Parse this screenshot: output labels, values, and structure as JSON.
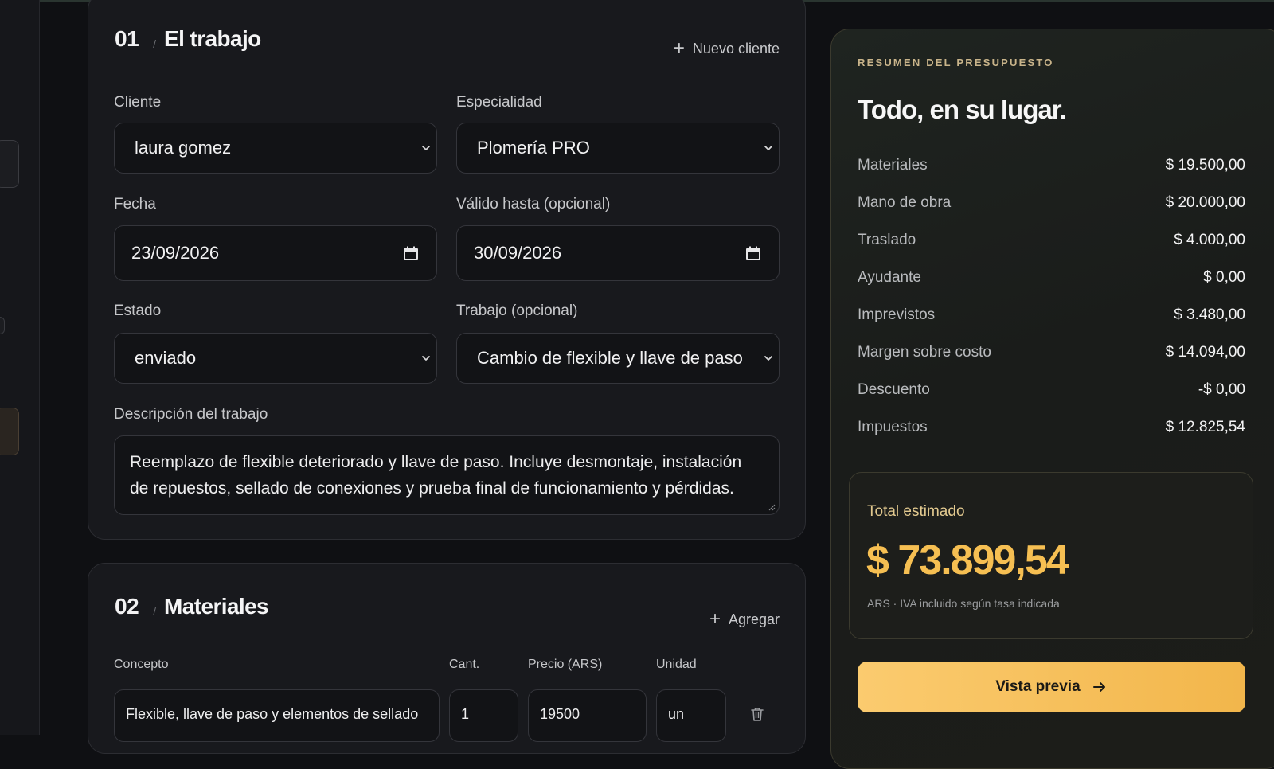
{
  "section1": {
    "number": "01",
    "slash": "/",
    "title": "El trabajo",
    "new_client_label": "Nuevo cliente",
    "client": {
      "label": "Cliente",
      "value": "laura gomez"
    },
    "specialty": {
      "label": "Especialidad",
      "value": "Plomería PRO"
    },
    "date": {
      "label": "Fecha",
      "value": "23/09/2026"
    },
    "valid_until": {
      "label": "Válido hasta (opcional)",
      "value": "30/09/2026"
    },
    "status": {
      "label": "Estado",
      "value": "enviado"
    },
    "job": {
      "label": "Trabajo (opcional)",
      "value": "Cambio de flexible y llave de paso"
    },
    "description": {
      "label": "Descripción del trabajo",
      "value": "Reemplazo de flexible deteriorado y llave de paso. Incluye desmontaje, instalación de repuestos, sellado de conexiones y prueba final de funcionamiento y pérdidas."
    }
  },
  "section2": {
    "number": "02",
    "slash": "/",
    "title": "Materiales",
    "add_label": "Agregar",
    "columns": {
      "concept": "Concepto",
      "qty": "Cant.",
      "price": "Precio (ARS)",
      "unit": "Unidad"
    },
    "rows": [
      {
        "concept": "Flexible, llave de paso y elementos de sellado",
        "qty": "1",
        "price": "19500",
        "unit": "un"
      }
    ]
  },
  "summary": {
    "eyebrow": "RESUMEN DEL PRESUPUESTO",
    "title": "Todo, en su lugar.",
    "items": [
      {
        "label": "Materiales",
        "value": "$ 19.500,00"
      },
      {
        "label": "Mano de obra",
        "value": "$ 20.000,00"
      },
      {
        "label": "Traslado",
        "value": "$ 4.000,00"
      },
      {
        "label": "Ayudante",
        "value": "$ 0,00"
      },
      {
        "label": "Imprevistos",
        "value": "$ 3.480,00"
      },
      {
        "label": "Margen sobre costo",
        "value": "$ 14.094,00"
      },
      {
        "label": "Descuento",
        "value": "-$ 0,00"
      },
      {
        "label": "Impuestos",
        "value": "$ 12.825,54"
      }
    ],
    "total_label": "Total estimado",
    "total_value": "$ 73.899,54",
    "total_note": "ARS · IVA incluido según tasa indicada",
    "cta_label": "Vista previa"
  },
  "icons": {
    "plus": "plus-icon",
    "chevron": "chevron-down-icon",
    "calendar": "calendar-icon",
    "trash": "trash-icon",
    "arrow": "arrow-right-icon"
  },
  "colors": {
    "accent": "#f6bf52",
    "background": "#0f1013",
    "card": "#18191d"
  }
}
